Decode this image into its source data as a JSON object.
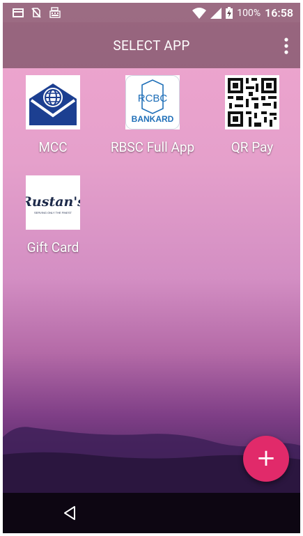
{
  "status_bar": {
    "battery": "100%",
    "time": "16:58",
    "icons": [
      "card-icon",
      "no-sim-icon",
      "cash-register-icon",
      "wifi-icon",
      "signal-icon",
      "battery-charging-icon"
    ]
  },
  "header": {
    "title": "SELECT APP",
    "menu_icon": "more-vert-icon"
  },
  "apps": [
    {
      "label": "MCC",
      "icon": "mcc-logo"
    },
    {
      "label": "RBSC Full App",
      "icon": "rcbc-bankard-logo",
      "logo_top": "RCBC",
      "logo_bottom": "BANKARD"
    },
    {
      "label": "QR Pay",
      "icon": "qr-code-icon"
    },
    {
      "label": "Gift Card",
      "icon": "rustans-logo",
      "logo_text": "Rustan's",
      "logo_subtext": "SERVING ONLY THE FINEST"
    }
  ],
  "fab": {
    "label": "+",
    "icon": "add-icon"
  },
  "nav": {
    "back_icon": "back-icon"
  },
  "colors": {
    "fab": "#e12a6a",
    "bankard_blue": "#1f6fb8",
    "mcc_blue": "#1c3f91",
    "rustans_navy": "#1d2a4a"
  }
}
